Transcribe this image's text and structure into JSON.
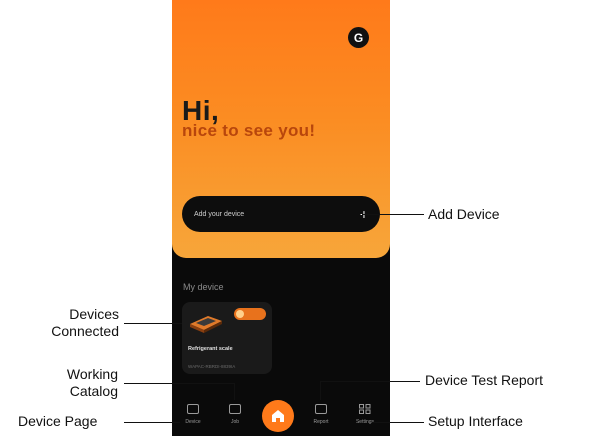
{
  "app": {
    "avatar_initial": "G",
    "greeting": "Hi,",
    "subtitle": "nice to see you!",
    "add_device_label": "Add your device",
    "add_icon": "plus-icon",
    "section_title": "My device",
    "device": {
      "name": "Refrigerant scale",
      "serial": "WAPAC-RBRDI-8839IA"
    },
    "tabs": [
      {
        "label": "Device",
        "icon": "device-icon"
      },
      {
        "label": "Job",
        "icon": "job-icon"
      },
      {
        "label": "Report",
        "icon": "report-icon"
      },
      {
        "label": "Settings",
        "icon": "settings-icon"
      }
    ],
    "home_icon": "home-icon"
  },
  "callouts": {
    "add_device": "Add Device",
    "devices_connected_1": "Devices",
    "devices_connected_2": "Connected",
    "working_catalog_1": "Working",
    "working_catalog_2": "Catalog",
    "device_test_report": "Device Test Report",
    "device_page": "Device Page",
    "setup_interface": "Setup Interface"
  },
  "colors": {
    "accent": "#ff7a1a",
    "background": "#0a0a0a"
  }
}
